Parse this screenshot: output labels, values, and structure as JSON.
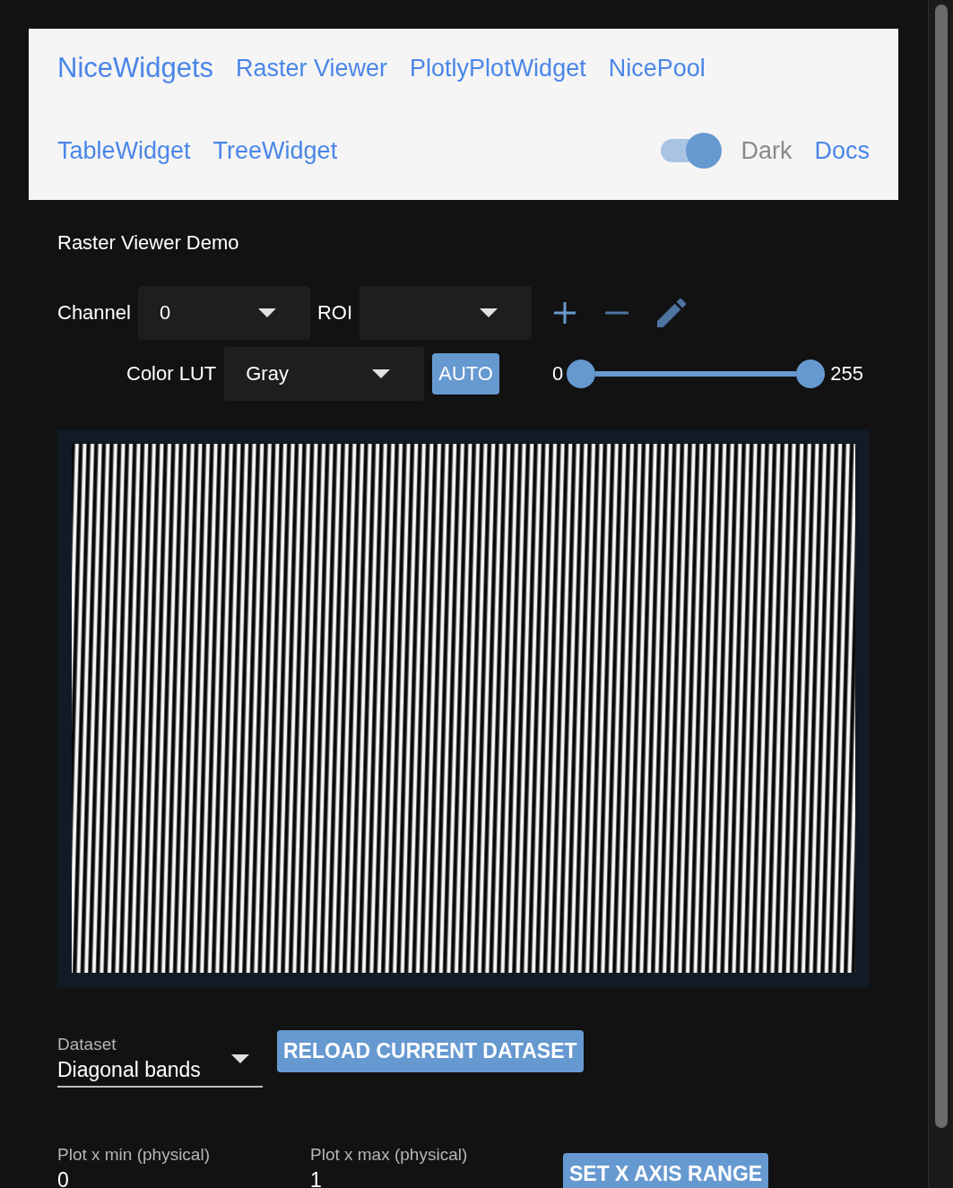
{
  "nav": {
    "brand": "NiceWidgets",
    "links": [
      {
        "label": "Raster Viewer"
      },
      {
        "label": "PlotlyPlotWidget"
      },
      {
        "label": "NicePool"
      },
      {
        "label": "TableWidget"
      },
      {
        "label": "TreeWidget"
      }
    ],
    "theme_toggle": {
      "label": "Dark",
      "on": true
    },
    "docs": "Docs"
  },
  "title": "Raster Viewer Demo",
  "channel": {
    "label": "Channel",
    "value": "0"
  },
  "roi": {
    "label": "ROI"
  },
  "tools": [
    {
      "kind": "add",
      "disabled": false
    },
    {
      "kind": "remove",
      "disabled": true
    },
    {
      "kind": "edit",
      "disabled": true
    }
  ],
  "lut": {
    "label": "Color LUT",
    "value": "Gray"
  },
  "auto_button": "AUTO",
  "range": {
    "min_label": "0",
    "max_label": "255",
    "thumbs": [
      {
        "level": 0
      },
      {
        "level": 1
      }
    ]
  },
  "dataset": {
    "label": "Dataset",
    "value": "Diagonal bands"
  },
  "reload_button": "RELOAD CURRENT DATASET",
  "plot_fields": [
    {
      "label": "Plot x min (physical)",
      "value": "0"
    },
    {
      "label": "Plot x max (physical)",
      "value": "1"
    }
  ],
  "set_button": "SET X AXIS RANGE"
}
